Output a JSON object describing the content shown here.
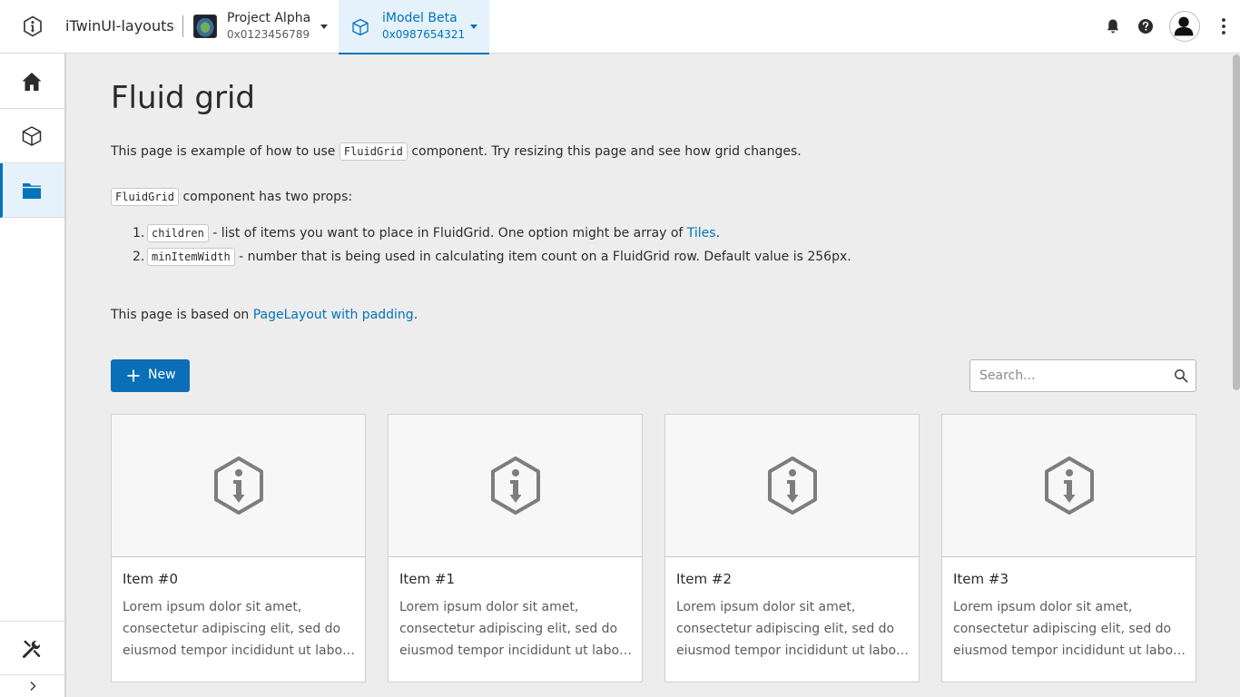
{
  "header": {
    "app_title": "iTwinUI-layouts",
    "project": {
      "name": "Project Alpha",
      "id": "0x0123456789"
    },
    "imodel": {
      "name": "iModel Beta",
      "id": "0x0987654321"
    }
  },
  "sidenav": {
    "items": [
      {
        "name": "home",
        "icon": "home-icon"
      },
      {
        "name": "models",
        "icon": "cube-icon"
      },
      {
        "name": "files",
        "icon": "folder-icon",
        "active": true
      }
    ],
    "bottom": {
      "icon": "tools-icon"
    },
    "expand": {
      "icon": "chevron-right-icon"
    }
  },
  "main": {
    "title": "Fluid grid",
    "intro": {
      "before": "This page is example of how to use ",
      "code": "FluidGrid",
      "after": " component. Try resizing this page and see how grid changes."
    },
    "props_intro": {
      "code": "FluidGrid",
      "after": " component has two props:"
    },
    "props": [
      {
        "num": "1.",
        "code": "children",
        "text": " - list of items you want to place in FluidGrid. One option might be array of ",
        "link": "Tiles",
        "tail": "."
      },
      {
        "num": "2.",
        "code": "minItemWidth",
        "text": " - number that is being used in calculating item count on a FluidGrid row. Default value is 256px."
      }
    ],
    "based_on": {
      "before": "This page is based on ",
      "link": "PageLayout with padding",
      "after": "."
    },
    "new_button": "New",
    "search": {
      "placeholder": "Search...",
      "value": ""
    },
    "tiles": [
      {
        "title": "Item #0",
        "lines": [
          "Lorem ipsum dolor sit amet,",
          "consectetur adipiscing elit, sed do",
          "eiusmod tempor incididunt ut labore..."
        ]
      },
      {
        "title": "Item #1",
        "lines": [
          "Lorem ipsum dolor sit amet,",
          "consectetur adipiscing elit, sed do",
          "eiusmod tempor incididunt ut labore..."
        ]
      },
      {
        "title": "Item #2",
        "lines": [
          "Lorem ipsum dolor sit amet,",
          "consectetur adipiscing elit, sed do",
          "eiusmod tempor incididunt ut labore..."
        ]
      },
      {
        "title": "Item #3",
        "lines": [
          "Lorem ipsum dolor sit amet,",
          "consectetur adipiscing elit, sed do",
          "eiusmod tempor incididunt ut labore..."
        ]
      }
    ]
  },
  "colors": {
    "accent": "#0073ba",
    "active_bg": "#e5f2fb",
    "page_bg": "#ededed"
  }
}
